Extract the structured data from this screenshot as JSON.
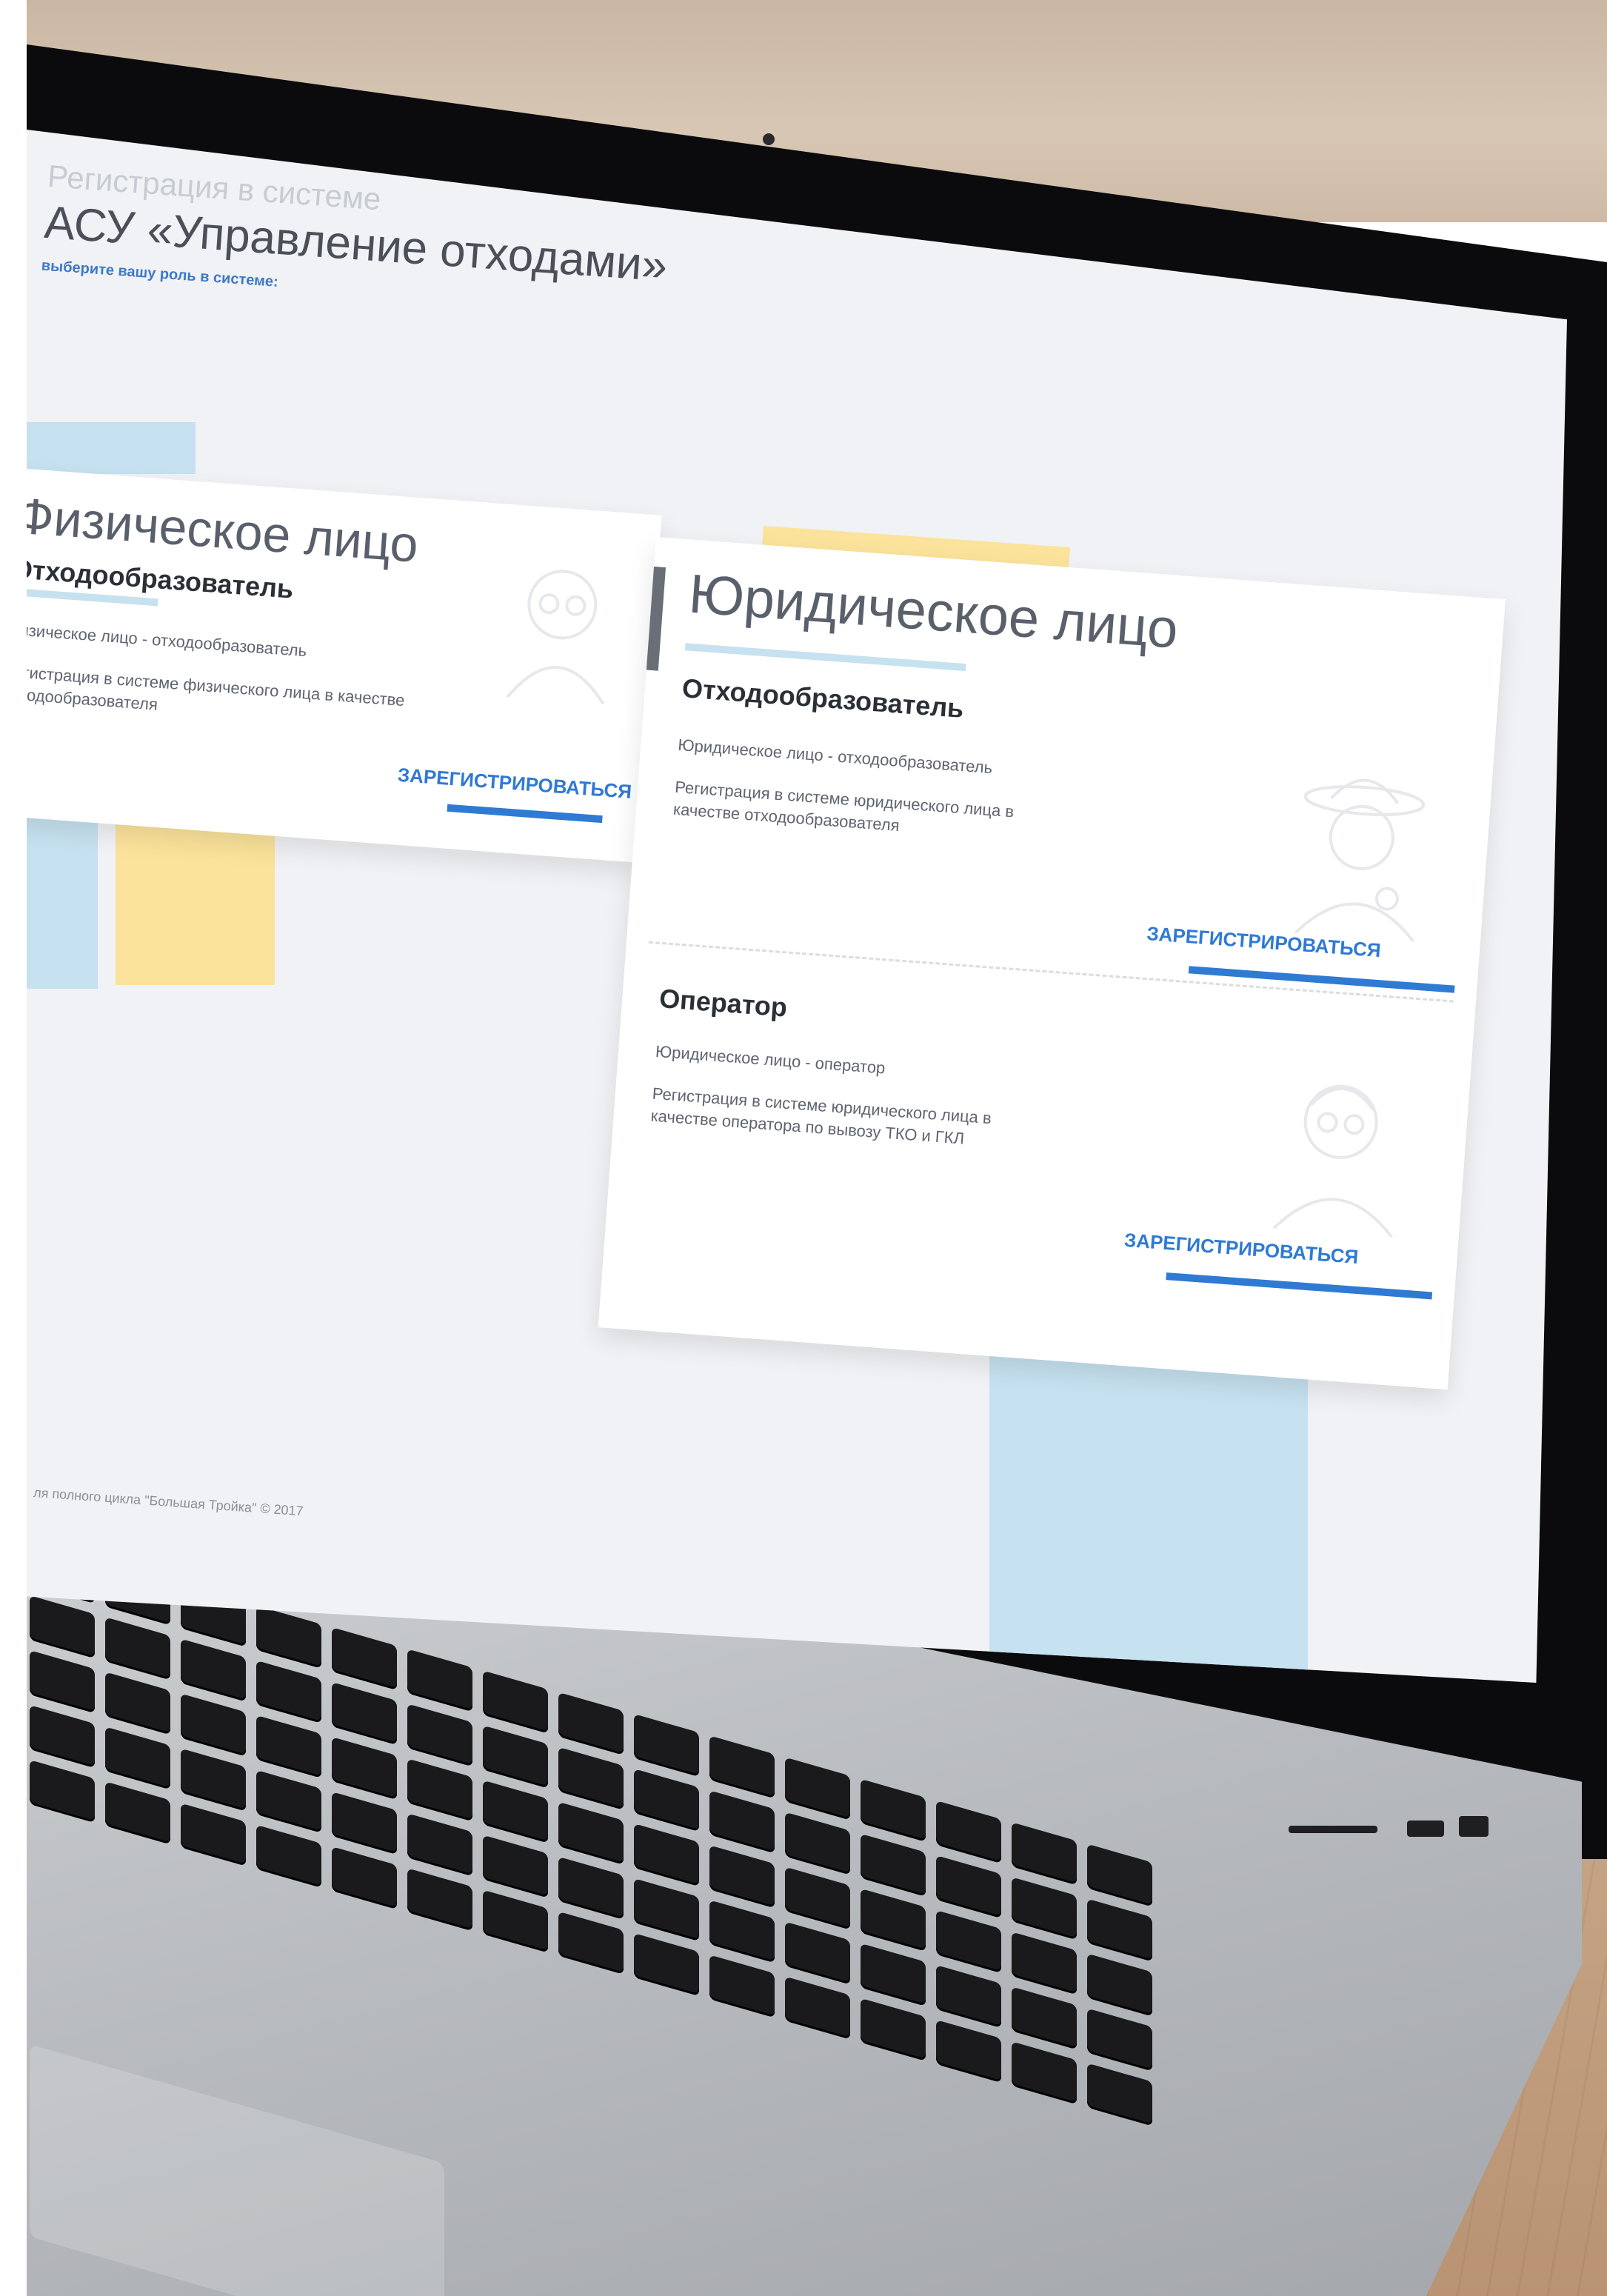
{
  "header": {
    "overline": "Регистрация в системе",
    "title": "АСУ «Управление отходами»",
    "choose_role": "выберите вашу роль в системе:"
  },
  "cards": {
    "physical": {
      "title": "Физическое лицо",
      "sections": [
        {
          "role": "Отходообразователь",
          "short": "Физическое лицо - отходообразователь",
          "desc": "Регистрация в системе физического лица в качестве отходообразователя",
          "action": "ЗАРЕГИСТРИРОВАТЬСЯ"
        }
      ]
    },
    "juridical": {
      "title": "Юридическое лицо",
      "sections": [
        {
          "role": "Отходообразователь",
          "short": "Юридическое лицо - отходообразователь",
          "desc": "Регистрация в системе юридического лица в качестве отходообразователя",
          "action": "ЗАРЕГИСТРИРОВАТЬСЯ"
        },
        {
          "role": "Оператор",
          "short": "Юридическое лицо - оператор",
          "desc": "Регистрация в системе юридического лица в качестве оператора по вывозу ТКО и ГКЛ",
          "action": "ЗАРЕГИСТРИРОВАТЬСЯ"
        }
      ]
    }
  },
  "footer": {
    "text": "ля полного цикла \"Большая Тройка\" © 2017"
  },
  "colors": {
    "accent_blue": "#2f7ad3",
    "deco_blue": "#c6e1f0",
    "deco_yellow": "#fbe39b",
    "screen_bg": "#f0f2f5"
  },
  "icons": {
    "avatar_1": "person-avatar-icon",
    "avatar_2": "farmer-avatar-icon",
    "avatar_3": "operator-avatar-icon"
  }
}
